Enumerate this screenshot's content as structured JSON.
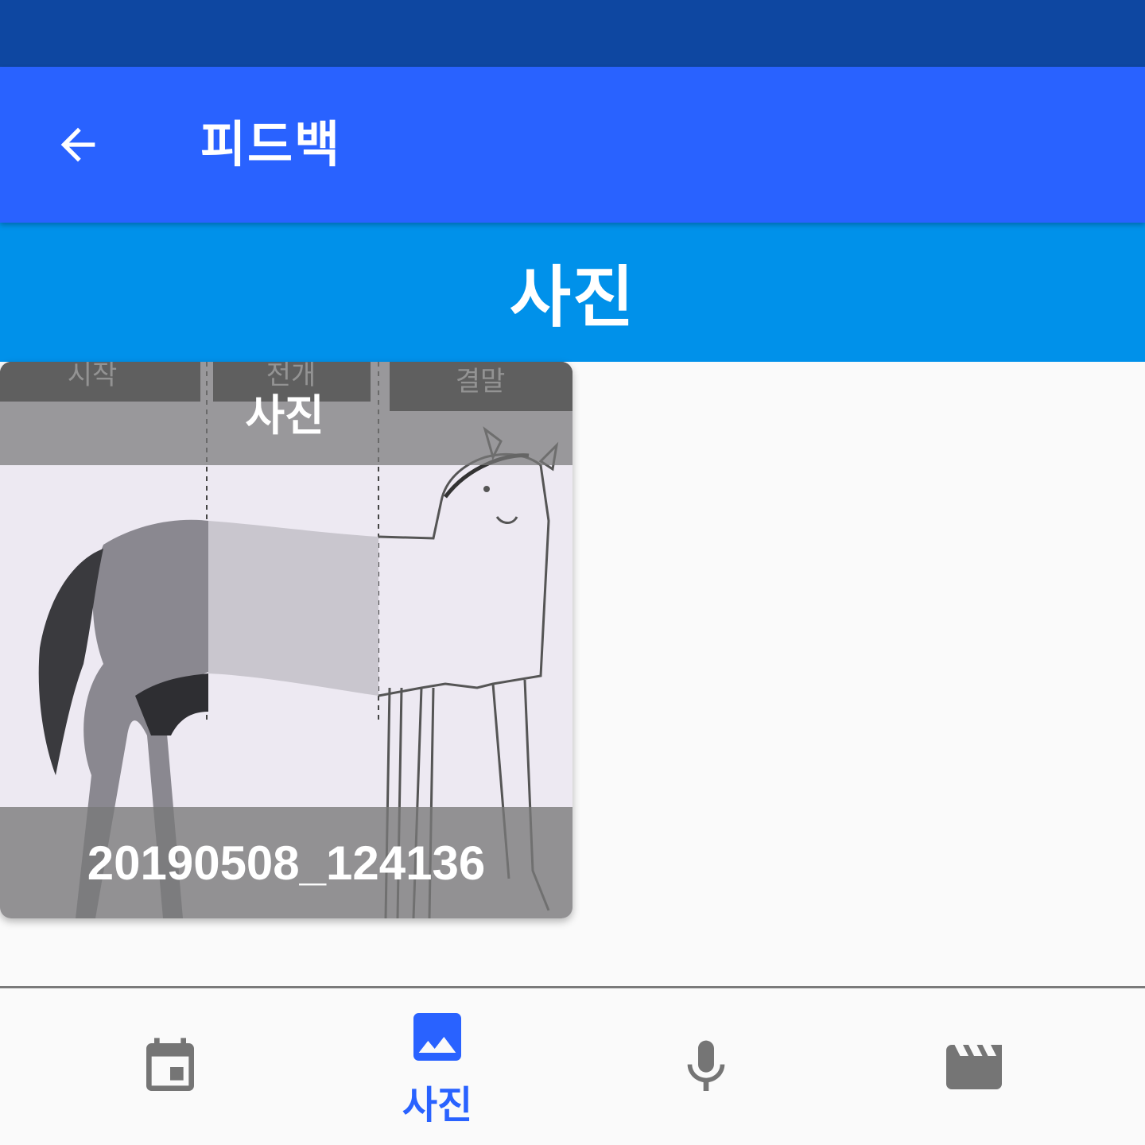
{
  "app_bar": {
    "title": "피드백",
    "back_icon": "arrow-back-icon"
  },
  "section": {
    "title": "사진"
  },
  "photo_card": {
    "top_label": "사진",
    "filename": "20190508_124136",
    "image_panel_labels": [
      "시작",
      "전개",
      "결말"
    ]
  },
  "bottom_nav": {
    "items": [
      {
        "icon": "calendar-icon",
        "label": "",
        "active": false
      },
      {
        "icon": "photo-icon",
        "label": "사진",
        "active": true
      },
      {
        "icon": "microphone-icon",
        "label": "",
        "active": false
      },
      {
        "icon": "movie-icon",
        "label": "",
        "active": false
      }
    ],
    "active_color": "#2962ff",
    "inactive_color": "#757575"
  },
  "colors": {
    "status_bar": "#0e47a1",
    "app_bar": "#2962ff",
    "section_header": "#0091ea"
  }
}
